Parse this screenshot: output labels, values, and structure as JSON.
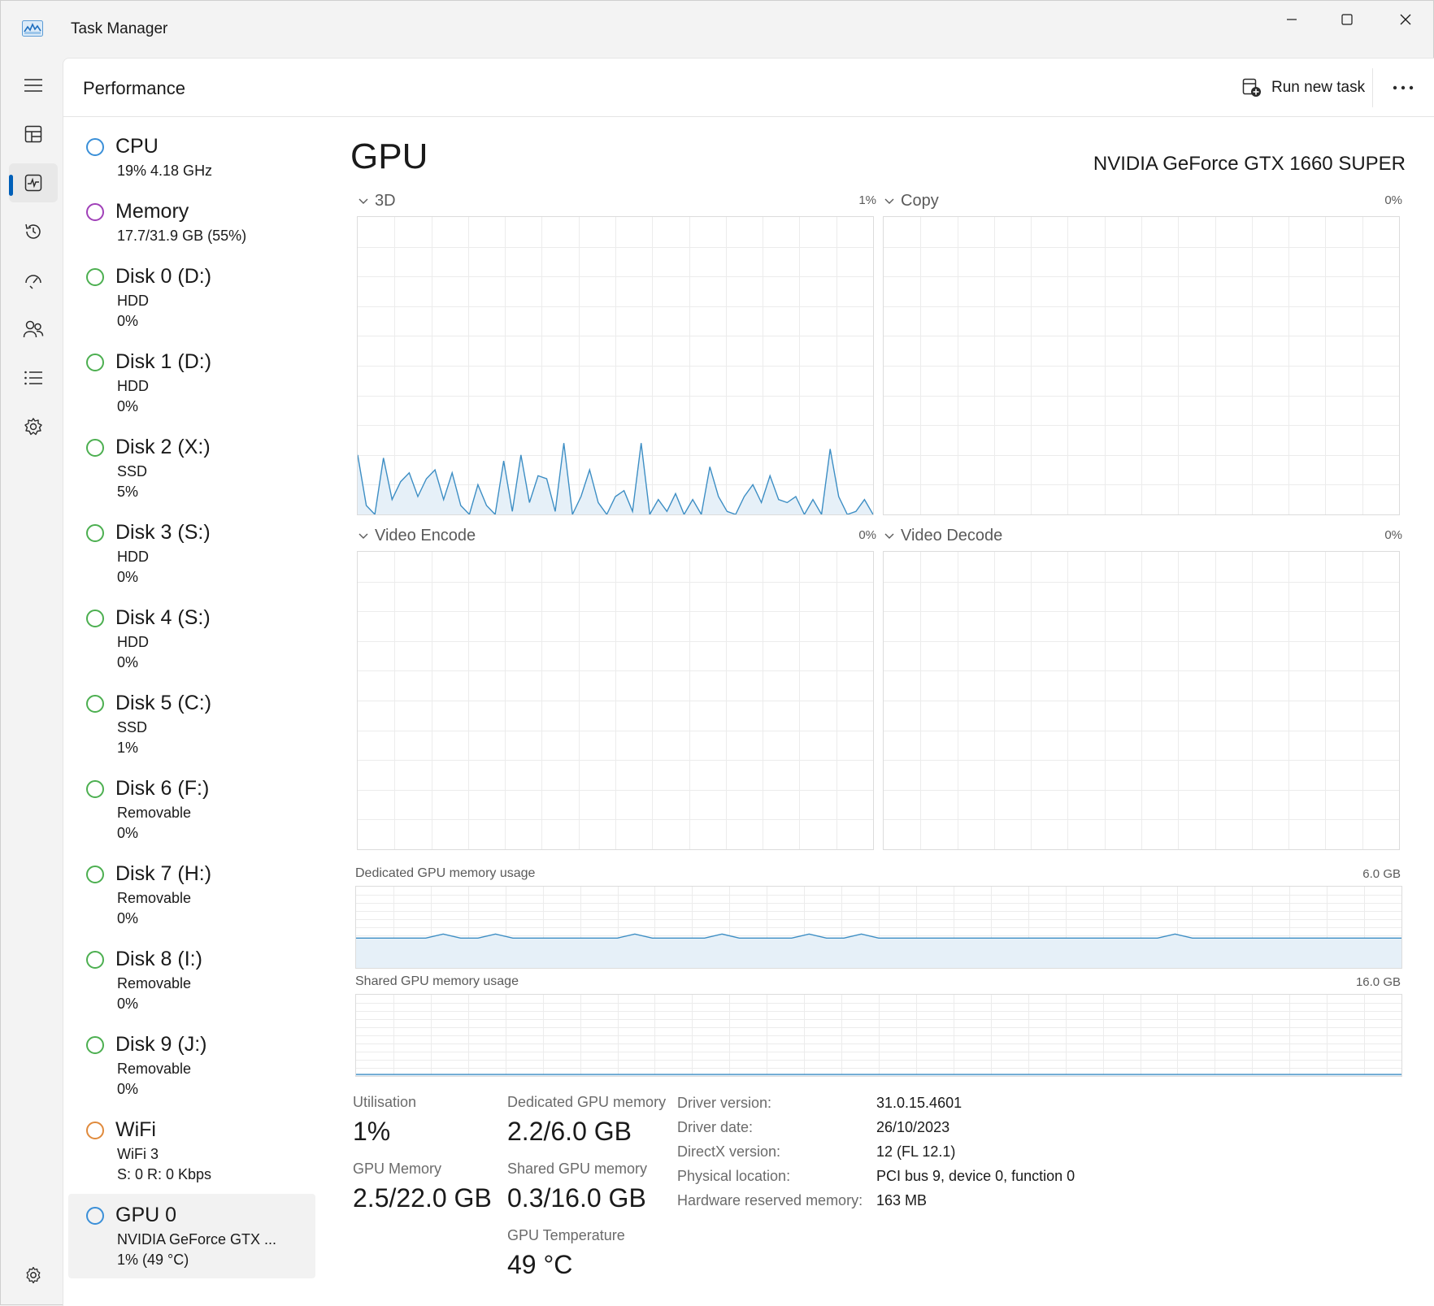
{
  "window": {
    "title": "Task Manager"
  },
  "header": {
    "page_title": "Performance",
    "run_new_task": "Run new task"
  },
  "nav": {
    "items": [
      "hamburger-menu-icon",
      "processes-icon",
      "performance-icon",
      "app-history-icon",
      "startup-apps-icon",
      "users-icon",
      "details-icon",
      "services-icon"
    ],
    "active": "performance-icon",
    "settings": "settings-icon"
  },
  "devices": [
    {
      "name": "CPU",
      "sub1": "19%  4.18 GHz",
      "sub2": "",
      "ring": "#3a8fd8"
    },
    {
      "name": "Memory",
      "sub1": "17.7/31.9 GB (55%)",
      "sub2": "",
      "ring": "#a040b8"
    },
    {
      "name": "Disk 0 (D:)",
      "sub1": "HDD",
      "sub2": "0%",
      "ring": "#4caf50"
    },
    {
      "name": "Disk 1 (D:)",
      "sub1": "HDD",
      "sub2": "0%",
      "ring": "#4caf50"
    },
    {
      "name": "Disk 2 (X:)",
      "sub1": "SSD",
      "sub2": "5%",
      "ring": "#4caf50"
    },
    {
      "name": "Disk 3 (S:)",
      "sub1": "HDD",
      "sub2": "0%",
      "ring": "#4caf50"
    },
    {
      "name": "Disk 4 (S:)",
      "sub1": "HDD",
      "sub2": "0%",
      "ring": "#4caf50"
    },
    {
      "name": "Disk 5 (C:)",
      "sub1": "SSD",
      "sub2": "1%",
      "ring": "#4caf50"
    },
    {
      "name": "Disk 6 (F:)",
      "sub1": "Removable",
      "sub2": "0%",
      "ring": "#4caf50"
    },
    {
      "name": "Disk 7 (H:)",
      "sub1": "Removable",
      "sub2": "0%",
      "ring": "#4caf50"
    },
    {
      "name": "Disk 8 (I:)",
      "sub1": "Removable",
      "sub2": "0%",
      "ring": "#4caf50"
    },
    {
      "name": "Disk 9 (J:)",
      "sub1": "Removable",
      "sub2": "0%",
      "ring": "#4caf50"
    },
    {
      "name": "WiFi",
      "sub1": "WiFi 3",
      "sub2": "S: 0  R: 0 Kbps",
      "ring": "#e08a3c"
    },
    {
      "name": "GPU 0",
      "sub1": "NVIDIA GeForce GTX ...",
      "sub2": "1%  (49 °C)",
      "ring": "#3a8fd8"
    }
  ],
  "gpu": {
    "title": "GPU",
    "model": "NVIDIA GeForce GTX 1660 SUPER",
    "engines": [
      {
        "label": "3D",
        "pct": "1%"
      },
      {
        "label": "Copy",
        "pct": "0%"
      },
      {
        "label": "Video Encode",
        "pct": "0%"
      },
      {
        "label": "Video Decode",
        "pct": "0%"
      }
    ],
    "dedicated_label": "Dedicated GPU memory usage",
    "dedicated_max": "6.0 GB",
    "shared_label": "Shared GPU memory usage",
    "shared_max": "16.0 GB",
    "stats": {
      "utilisation_label": "Utilisation",
      "utilisation": "1%",
      "dedicated_mem_label": "Dedicated GPU memory",
      "dedicated_mem": "2.2/6.0 GB",
      "gpu_mem_label": "GPU Memory",
      "gpu_mem": "2.5/22.0 GB",
      "shared_mem_label": "Shared GPU memory",
      "shared_mem": "0.3/16.0 GB",
      "temp_label": "GPU Temperature",
      "temp": "49 °C"
    },
    "info": [
      {
        "key": "Driver version:",
        "val": "31.0.15.4601"
      },
      {
        "key": "Driver date:",
        "val": "26/10/2023"
      },
      {
        "key": "DirectX version:",
        "val": "12 (FL 12.1)"
      },
      {
        "key": "Physical location:",
        "val": "PCI bus 9, device 0, function 0"
      },
      {
        "key": "Hardware reserved memory:",
        "val": "163 MB"
      }
    ]
  },
  "chart_data": [
    {
      "type": "area",
      "name": "3D",
      "ylim": [
        0,
        100
      ],
      "values": [
        20,
        3,
        0,
        19,
        5,
        11,
        14,
        6,
        12,
        15,
        5,
        14,
        3,
        0,
        10,
        3,
        0,
        18,
        1,
        20,
        4,
        13,
        12,
        1,
        24,
        0,
        6,
        15,
        4,
        0,
        6,
        8,
        1,
        24,
        0,
        5,
        1,
        7,
        0,
        5,
        0,
        16,
        6,
        1,
        0,
        6,
        10,
        4,
        13,
        5,
        4,
        6,
        0,
        5,
        0,
        22,
        6,
        0,
        1,
        5,
        0
      ]
    },
    {
      "type": "area",
      "name": "Copy",
      "ylim": [
        0,
        100
      ],
      "values": []
    },
    {
      "type": "area",
      "name": "Video Encode",
      "ylim": [
        0,
        100
      ],
      "values": []
    },
    {
      "type": "area",
      "name": "Video Decode",
      "ylim": [
        0,
        100
      ],
      "values": []
    },
    {
      "type": "area",
      "name": "Dedicated GPU memory usage",
      "ylim": [
        0,
        6.0
      ],
      "values": [
        2.2,
        2.2,
        2.2,
        2.2,
        2.2,
        2.2,
        2.2,
        2.2,
        2.2,
        2.2,
        2.2,
        2.2,
        2.2,
        2.2,
        2.2,
        2.2,
        2.2,
        2.2,
        2.2,
        2.2,
        2.2,
        2.2,
        2.2,
        2.2,
        2.2,
        2.2,
        2.2,
        2.2,
        2.2,
        2.2,
        2.2,
        2.2,
        2.2,
        2.2,
        2.2,
        2.2,
        2.2,
        2.2,
        2.2,
        2.2,
        2.2,
        2.2,
        2.2,
        2.2,
        2.2,
        2.2,
        2.2,
        2.2,
        2.2,
        2.2,
        2.2,
        2.2,
        2.2,
        2.2,
        2.2,
        2.2,
        2.2,
        2.2,
        2.2,
        2.2,
        2.2
      ],
      "peaks": [
        [
          5,
          2.5
        ],
        [
          8,
          2.5
        ],
        [
          16,
          2.5
        ],
        [
          21,
          2.5
        ],
        [
          26,
          2.5
        ],
        [
          29,
          2.5
        ],
        [
          47,
          2.5
        ]
      ]
    },
    {
      "type": "area",
      "name": "Shared GPU memory usage",
      "ylim": [
        0,
        16.0
      ],
      "values": [
        0.3,
        0.3,
        0.3,
        0.3,
        0.3,
        0.3,
        0.3,
        0.3,
        0.3,
        0.3,
        0.3,
        0.3,
        0.3,
        0.3,
        0.3,
        0.3,
        0.3,
        0.3,
        0.3,
        0.3,
        0.3,
        0.3,
        0.3,
        0.3,
        0.3,
        0.3,
        0.3,
        0.3,
        0.3,
        0.3,
        0.3
      ]
    }
  ]
}
